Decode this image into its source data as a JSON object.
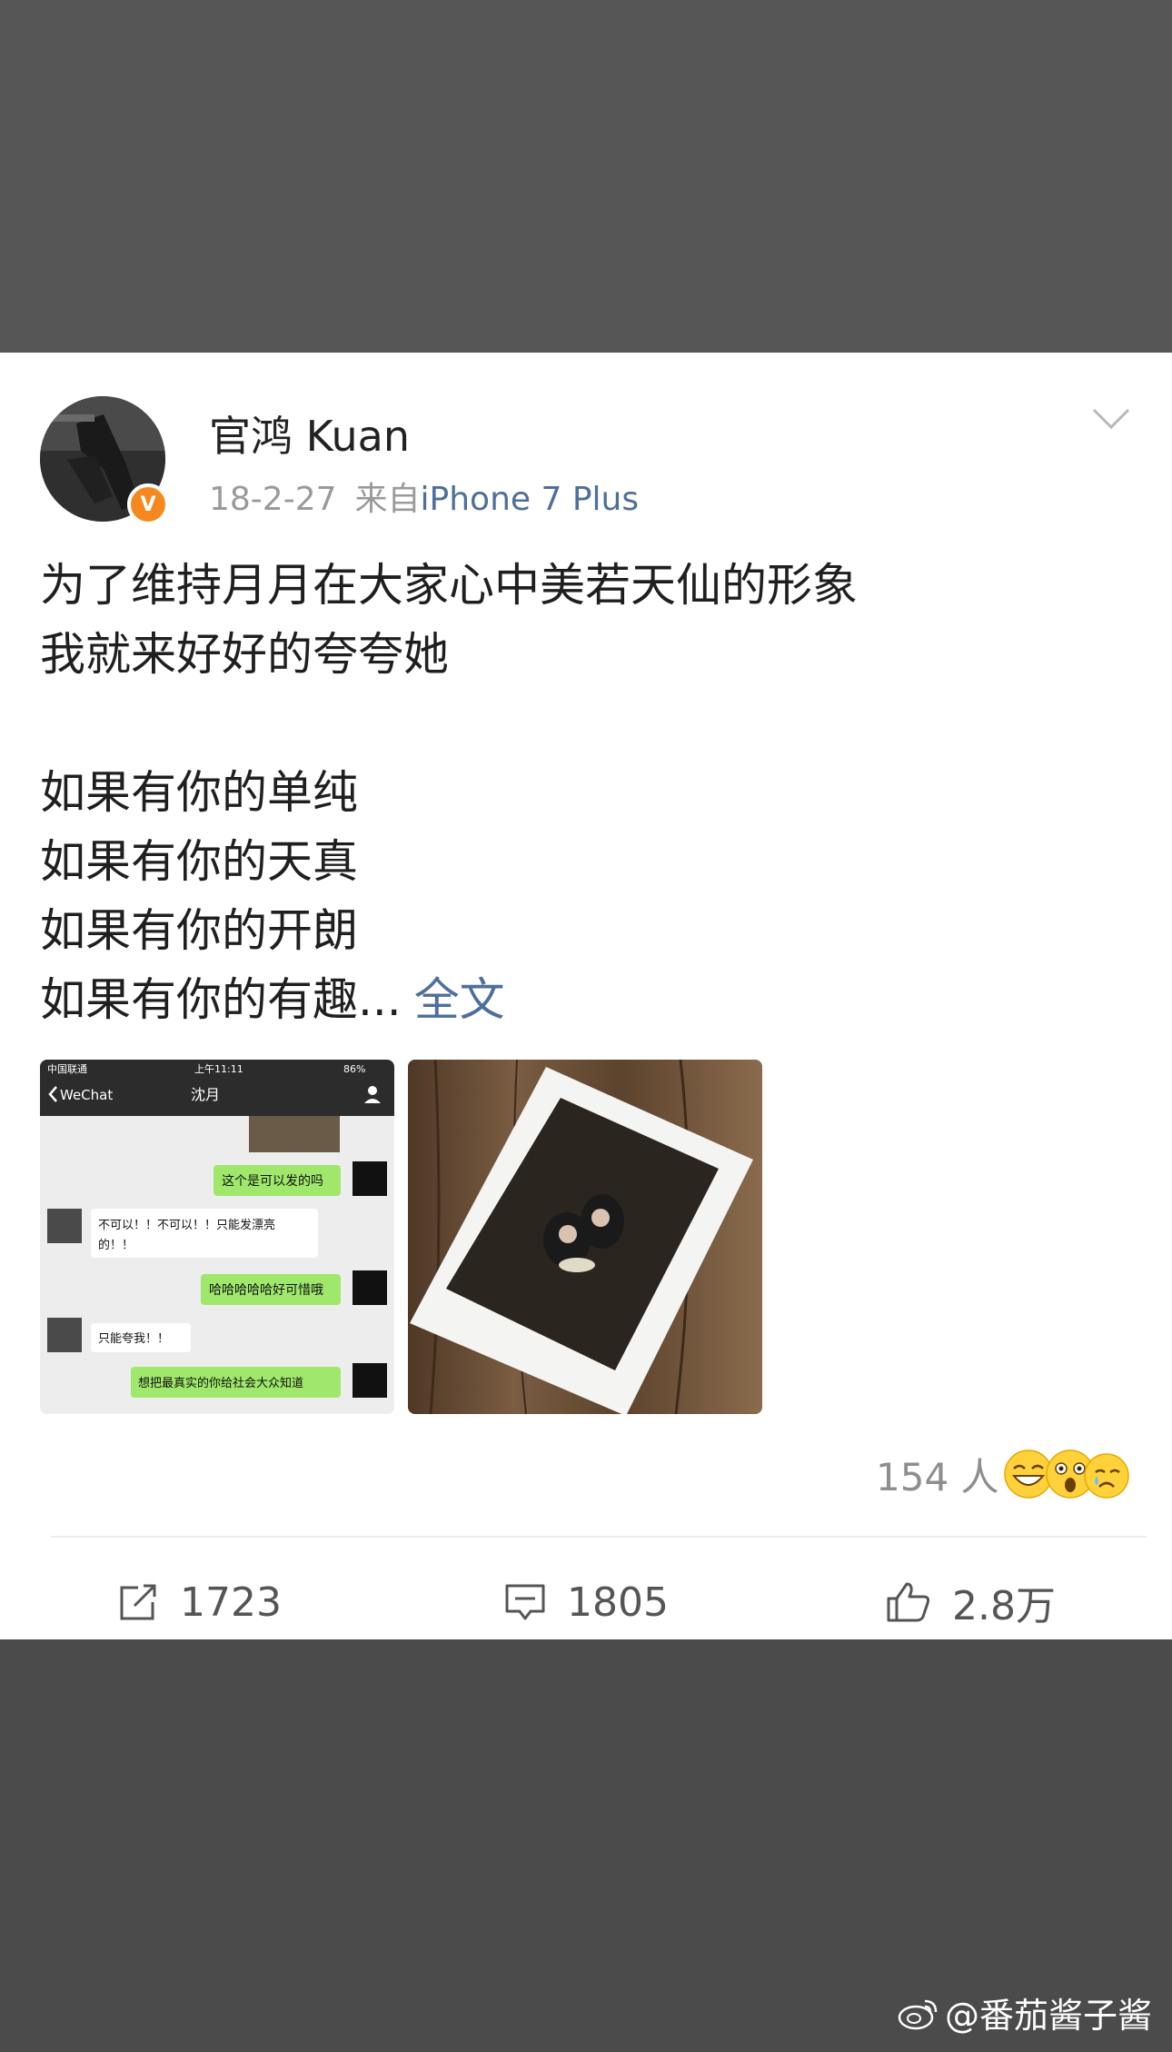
{
  "post": {
    "username": "官鸿 Kuan",
    "date": "18-2-27",
    "source_prefix": "来自",
    "source_device": "iPhone 7 Plus",
    "text_lines": [
      "为了维持月月在大家心中美若天仙的形象",
      "我就来好好的夸夸她",
      "",
      "如果有你的单纯",
      "如果有你的天真",
      "如果有你的开朗"
    ],
    "last_line": "如果有你的有趣...",
    "expand_label": "全文",
    "reaction_count": "154 人"
  },
  "chat_image": {
    "carrier": "中国联通",
    "time": "上午11:11",
    "battery": "86%",
    "back_label": "WeChat",
    "contact": "沈月",
    "messages": [
      {
        "side": "right",
        "text": "这个是可以发的吗"
      },
      {
        "side": "left",
        "text": "不可以！！不可以！！只能发漂亮"
      },
      {
        "side": "left",
        "text": "的！！"
      },
      {
        "side": "right",
        "text": "哈哈哈哈哈好可惜哦"
      },
      {
        "side": "left",
        "text": "只能夸我！！"
      },
      {
        "side": "right",
        "text": "想把最真实的你给社会大众知道"
      }
    ]
  },
  "actions": {
    "share_count": "1723",
    "comment_count": "1805",
    "like_count": "2.8万"
  },
  "watermark": "@番茄酱子酱",
  "colors": {
    "link": "#4e6f9a",
    "verified_badge": "#f5891f",
    "wechat_green": "#9fe86b"
  }
}
